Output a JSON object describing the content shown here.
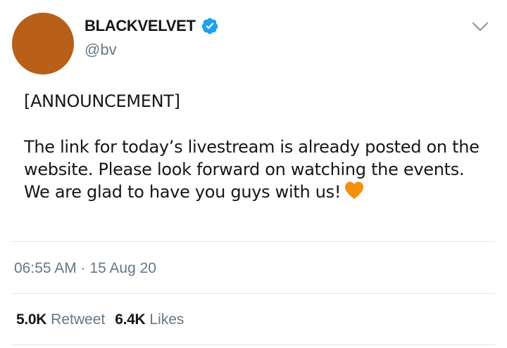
{
  "tweet": {
    "author": {
      "display_name": "BLACKVELVET",
      "handle": "@bv",
      "verified": true,
      "avatar_color": "#b85f1a"
    },
    "body": {
      "line1": "[ANNOUNCEMENT]",
      "line2": "The link for today’s livestream is already posted on the website. Please look forward on watching the events. We are glad to have you guys with us!",
      "emoji": "orange-heart-icon"
    },
    "timestamp": "06:55 AM · 15 Aug 20",
    "stats": {
      "retweets_count": "5.0K",
      "retweets_label": "Retweet",
      "likes_count": "6.4K",
      "likes_label": "Likes"
    }
  },
  "colors": {
    "text_primary": "#14171a",
    "text_secondary": "#657786",
    "verified_blue": "#1da1f2",
    "divider": "#e1e8ed",
    "heart_orange": "#f4900c"
  }
}
